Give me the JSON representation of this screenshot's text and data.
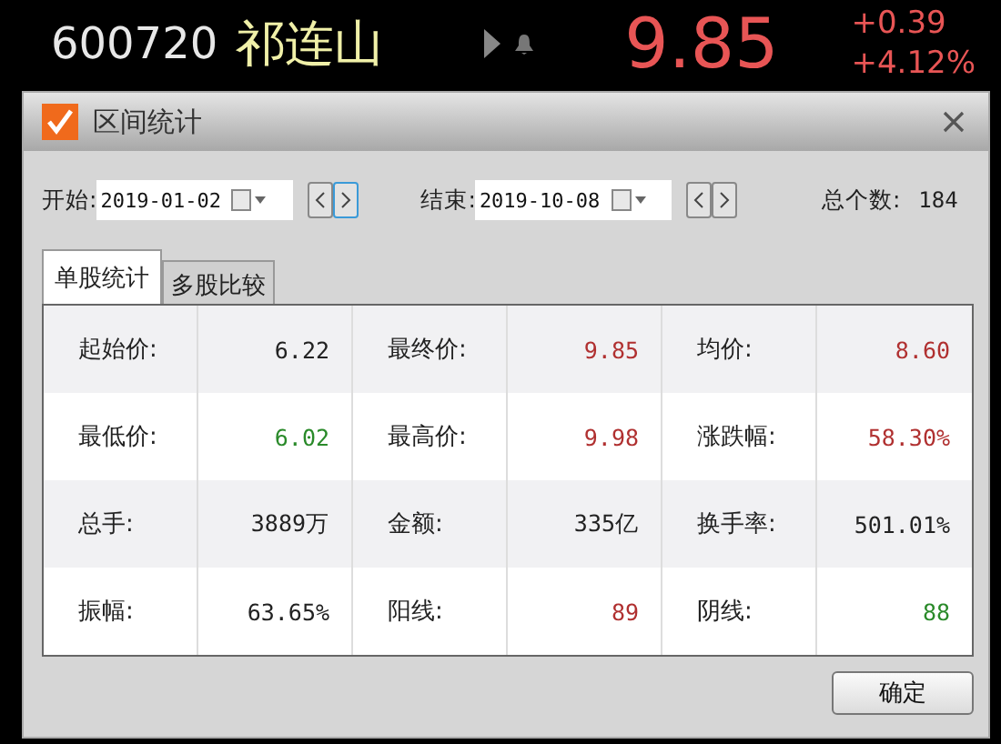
{
  "quote": {
    "code": "600720",
    "name": "祁连山",
    "price": "9.85",
    "change": "+0.39",
    "change_pct": "+4.12%"
  },
  "dialog": {
    "title": "区间统计",
    "checked": true,
    "start_label": "开始:",
    "start_date": "2019-01-02",
    "end_label": "结束:",
    "end_date": "2019-10-08",
    "count_label": "总个数:",
    "count": "184",
    "tabs": [
      {
        "label": "单股统计",
        "selected": true
      },
      {
        "label": "多股比较",
        "selected": false
      }
    ],
    "rows": [
      [
        {
          "label": "起始价:",
          "value": "6.22",
          "color": "#222222"
        },
        {
          "label": "最终价:",
          "value": "9.85",
          "color": "#b03030"
        },
        {
          "label": "均价:",
          "value": "8.60",
          "color": "#b03030"
        }
      ],
      [
        {
          "label": "最低价:",
          "value": "6.02",
          "color": "#2a8a2a"
        },
        {
          "label": "最高价:",
          "value": "9.98",
          "color": "#b03030"
        },
        {
          "label": "涨跌幅:",
          "value": "58.30%",
          "color": "#b03030"
        }
      ],
      [
        {
          "label": "总手:",
          "value": "3889万",
          "color": "#222222"
        },
        {
          "label": "金额:",
          "value": "335亿",
          "color": "#222222"
        },
        {
          "label": "换手率:",
          "value": "501.01%",
          "color": "#222222"
        }
      ],
      [
        {
          "label": "振幅:",
          "value": "63.65%",
          "color": "#222222"
        },
        {
          "label": "阳线:",
          "value": "89",
          "color": "#b03030"
        },
        {
          "label": "阴线:",
          "value": "88",
          "color": "#2a8a2a"
        }
      ]
    ],
    "ok_button": "确定"
  }
}
